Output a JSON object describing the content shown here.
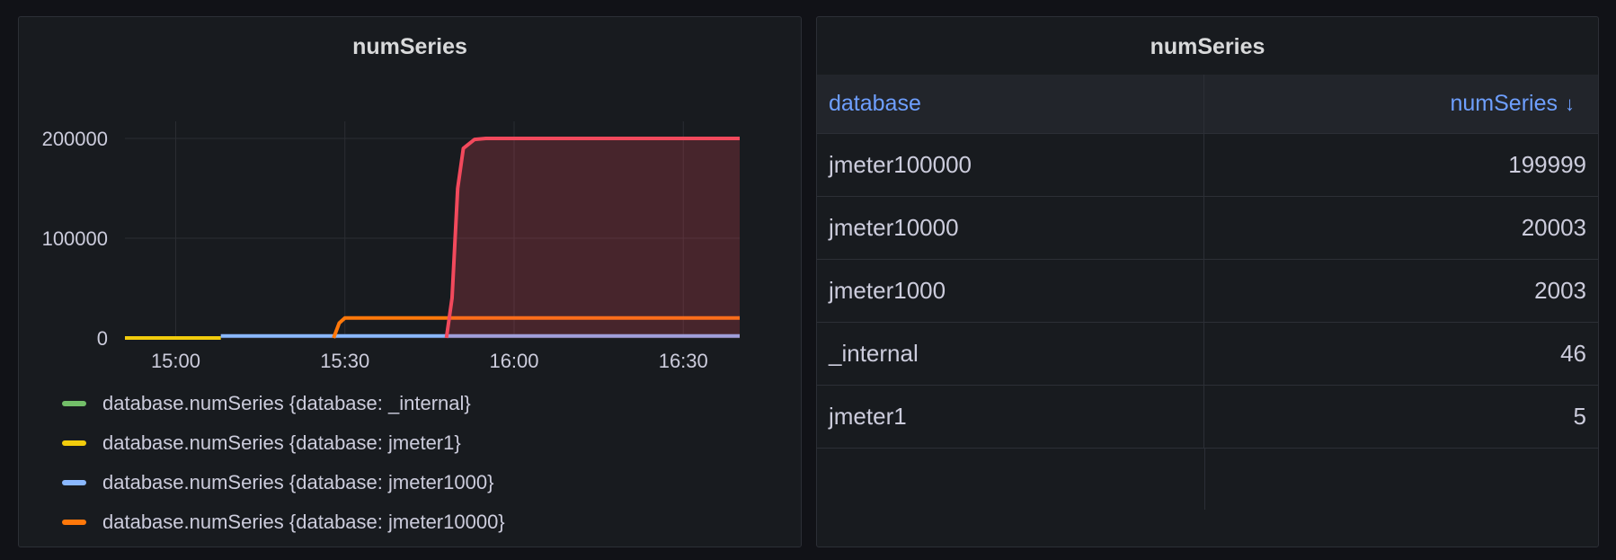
{
  "timeseries_panel": {
    "title": "numSeries",
    "legend": [
      {
        "label": "database.numSeries {database: _internal}",
        "color": "#73bf69"
      },
      {
        "label": "database.numSeries {database: jmeter1}",
        "color": "#f2cc0c"
      },
      {
        "label": "database.numSeries {database: jmeter1000}",
        "color": "#8ab8ff"
      },
      {
        "label": "database.numSeries {database: jmeter10000}",
        "color": "#ff780a"
      }
    ]
  },
  "table_panel": {
    "title": "numSeries",
    "columns": [
      {
        "label": "database"
      },
      {
        "label": "numSeries",
        "sort_icon": "↓"
      }
    ],
    "rows": [
      {
        "database": "jmeter100000",
        "numSeries": "199999"
      },
      {
        "database": "jmeter10000",
        "numSeries": "20003"
      },
      {
        "database": "jmeter1000",
        "numSeries": "2003"
      },
      {
        "database": "_internal",
        "numSeries": "46"
      },
      {
        "database": "jmeter1",
        "numSeries": "5"
      }
    ]
  },
  "chart_data": {
    "type": "area",
    "title": "numSeries",
    "xlabel": "",
    "ylabel": "",
    "x_ticks": [
      "15:00",
      "15:30",
      "16:00",
      "16:30"
    ],
    "y_ticks": [
      "0",
      "100000",
      "200000"
    ],
    "xlim": [
      "14:51",
      "16:40"
    ],
    "ylim": [
      0,
      200000
    ],
    "grid": true,
    "legend_position": "bottom",
    "series": [
      {
        "name": "database.numSeries {database: jmeter1}",
        "color": "#f2cc0c",
        "points": [
          [
            "14:51",
            5
          ],
          [
            "15:08",
            5
          ]
        ]
      },
      {
        "name": "database.numSeries {database: jmeter1000}",
        "color": "#8ab8ff",
        "points": [
          [
            "15:08",
            2003
          ],
          [
            "15:28",
            2003
          ],
          [
            "16:40",
            2003
          ]
        ]
      },
      {
        "name": "database.numSeries {database: jmeter10000}",
        "color": "#ff780a",
        "points": [
          [
            "15:28",
            0
          ],
          [
            "15:29",
            15000
          ],
          [
            "15:30",
            20003
          ],
          [
            "16:40",
            20003
          ]
        ]
      },
      {
        "name": "",
        "color": "#f2495c",
        "fill": true,
        "points": [
          [
            "15:48",
            0
          ],
          [
            "15:49",
            40000
          ],
          [
            "15:50",
            150000
          ],
          [
            "15:51",
            190000
          ],
          [
            "15:53",
            199000
          ],
          [
            "15:55",
            199999
          ],
          [
            "16:40",
            199999
          ]
        ]
      }
    ]
  }
}
